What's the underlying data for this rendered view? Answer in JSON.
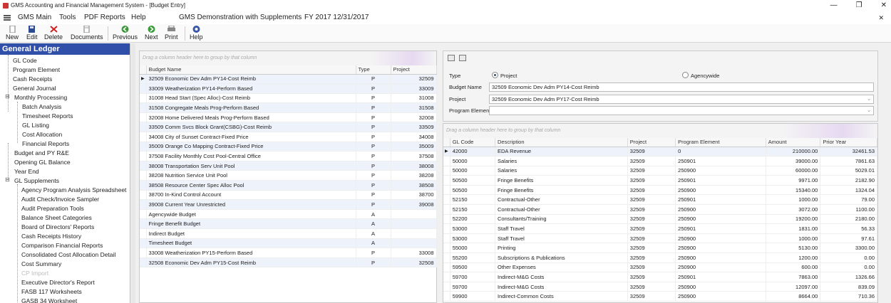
{
  "window": {
    "title": "GMS Accounting and Financial Management System - [Budget Entry]",
    "min": "—",
    "max": "❐",
    "close": "✕"
  },
  "menu": {
    "items": [
      "GMS Main",
      "Tools",
      "PDF Reports",
      "Help"
    ],
    "context": "GMS Demonstration with Supplements",
    "fiscal": "FY 2017 12/31/2017",
    "close": "✕"
  },
  "toolbar": {
    "new": "New",
    "edit": "Edit",
    "delete": "Delete",
    "documents": "Documents",
    "previous": "Previous",
    "next": "Next",
    "print": "Print",
    "help": "Help"
  },
  "nav": {
    "header": "General Ledger",
    "items": [
      "GL Code",
      "Program Element",
      "Cash Receipts",
      "General Journal",
      "Monthly Processing",
      "Batch Analysis",
      "Timesheet Reports",
      "GL Listing",
      "Cost Allocation",
      "Financial Reports",
      "Budget and PY R&E",
      "Opening GL Balance",
      "Year End",
      "GL Supplements",
      "Agency Program Analysis Spreadsheet",
      "Audit Check/Invoice Sampler",
      "Audit Preparation Tools",
      "Balance Sheet Categories",
      "Board of Directors' Reports",
      "Cash Receipts History",
      "Comparison Financial Reports",
      "Consolidated Cost Allocation Detail",
      "Cost Summary",
      "CP Import",
      "Executive Director's Report",
      "FASB 117 Worksheets",
      "GASB 34 Worksheet"
    ]
  },
  "budgets": {
    "group_hint": "Drag a column header here to group by that column",
    "headers": [
      "Budget Name",
      "Type",
      "Project"
    ],
    "rows": [
      [
        "32509 Economic Dev Adm PY14-Cost Reimb",
        "P",
        "32509"
      ],
      [
        "33009 Weatherization  PY14-Perform Based",
        "P",
        "33009"
      ],
      [
        "31008 Head Start (Spec Alloc)-Cost Reimb",
        "P",
        "31008"
      ],
      [
        "31508 Congregate Meals Prog-Perform Based",
        "P",
        "31508"
      ],
      [
        "32008 Home Delivered Meals Prog-Perform Based",
        "P",
        "32008"
      ],
      [
        "33509 Comm Svcs Block Grant(CSBG)-Cost Reimb",
        "P",
        "33509"
      ],
      [
        "34008 City of Sunset Contract-Fixed Price",
        "P",
        "34008"
      ],
      [
        "35009 Orange Co Mapping Contract-Fixed Price",
        "P",
        "35009"
      ],
      [
        "37508 Facility Monthly Cost Pool-Central Office",
        "P",
        "37508"
      ],
      [
        "38008 Transportation Serv Unit Pool",
        "P",
        "38008"
      ],
      [
        "38208 Nutrition Service Unit Pool",
        "P",
        "38208"
      ],
      [
        "38508 Resource Center Spec Alloc Pool",
        "P",
        "38508"
      ],
      [
        "38700 In-Kind Control Account",
        "P",
        "38700"
      ],
      [
        "39008 Current Year Unrestricted",
        "P",
        "39008"
      ],
      [
        "Agencywide Budget",
        "A",
        ""
      ],
      [
        "Fringe Benefit Budget",
        "A",
        ""
      ],
      [
        "Indirect Budget",
        "A",
        ""
      ],
      [
        "Timesheet Budget",
        "A",
        ""
      ],
      [
        "33008 Weatherization PY15-Perform Based",
        "P",
        "33008"
      ],
      [
        "32508 Economic Dev Adm PY15-Cost Reimb",
        "P",
        "32508"
      ]
    ]
  },
  "detail": {
    "type_label": "Type",
    "type_options": [
      "Project",
      "Agencywide"
    ],
    "budget_name_label": "Budget Name",
    "budget_name_value": "32509 Economic Dev Adm PY14-Cost Reimb",
    "project_label": "Project",
    "project_value": "32509 Economic Dev Adm PY17-Cost Reimb",
    "program_element_label": "Program Element",
    "program_element_value": ""
  },
  "lines": {
    "group_hint": "Drag a column header here to group by that column",
    "headers": [
      "GL Code",
      "Description",
      "Project",
      "Program Element",
      "Amount",
      "Prior Year"
    ],
    "rows": [
      [
        "42000",
        "EDA Revenue",
        "32509",
        "0",
        "210000.00",
        "32461.53"
      ],
      [
        "50000",
        "Salaries",
        "32509",
        "250901",
        "39000.00",
        "7861.63"
      ],
      [
        "50000",
        "Salaries",
        "32509",
        "250900",
        "60000.00",
        "5029.01"
      ],
      [
        "50500",
        "Fringe Benefits",
        "32509",
        "250901",
        "9971.00",
        "2182.90"
      ],
      [
        "50500",
        "Fringe Benefits",
        "32509",
        "250900",
        "15340.00",
        "1324.04"
      ],
      [
        "52150",
        "Contractual-Other",
        "32509",
        "250901",
        "1000.00",
        "79.00"
      ],
      [
        "52150",
        "Contractual-Other",
        "32509",
        "250900",
        "3072.00",
        "1100.00"
      ],
      [
        "52200",
        "Consultants/Training",
        "32509",
        "250900",
        "19200.00",
        "2180.00"
      ],
      [
        "53000",
        "Staff Travel",
        "32509",
        "250901",
        "1831.00",
        "56.33"
      ],
      [
        "53000",
        "Staff Travel",
        "32509",
        "250900",
        "1000.00",
        "97.61"
      ],
      [
        "55000",
        "Printing",
        "32509",
        "250900",
        "5130.00",
        "3300.00"
      ],
      [
        "55200",
        "Subscriptions & Publications",
        "32509",
        "250900",
        "1200.00",
        "0.00"
      ],
      [
        "59500",
        "Other Expenses",
        "32509",
        "250900",
        "600.00",
        "0.00"
      ],
      [
        "59700",
        "Indirect-M&G Costs",
        "32509",
        "250901",
        "7863.00",
        "1326.66"
      ],
      [
        "59700",
        "Indirect-M&G Costs",
        "32509",
        "250900",
        "12097.00",
        "839.09"
      ],
      [
        "59900",
        "Indirect-Common Costs",
        "32509",
        "250900",
        "8664.00",
        "710.36"
      ]
    ]
  },
  "colors": {
    "nav_header": "#2f4fa8",
    "selection": "#eef2fb",
    "accent_group": "#e6d9f1"
  }
}
